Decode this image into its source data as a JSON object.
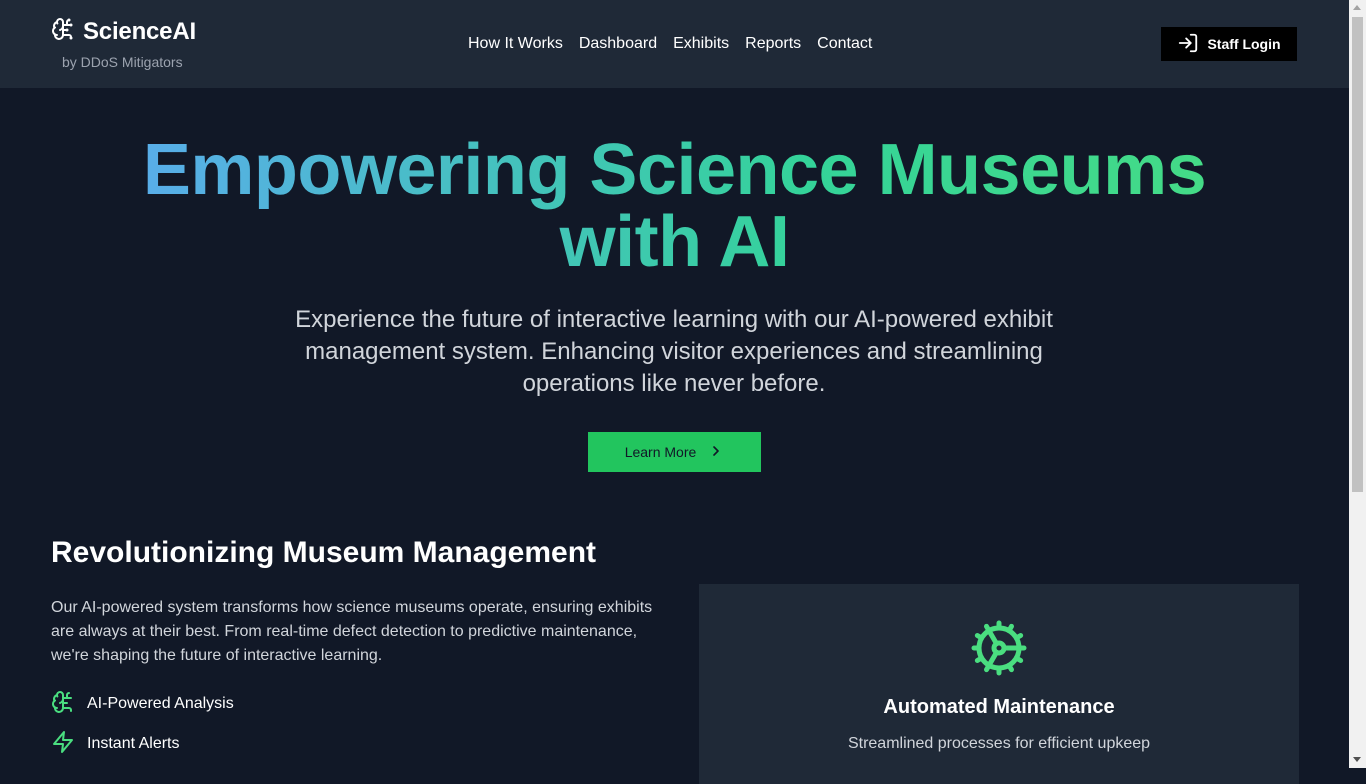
{
  "brand": {
    "name": "ScienceAI",
    "subtitle": "by DDoS Mitigators",
    "icon": "brain-icon"
  },
  "nav": {
    "links": [
      "How It Works",
      "Dashboard",
      "Exhibits",
      "Reports",
      "Contact"
    ],
    "login_label": "Staff Login",
    "login_icon": "log-in-icon"
  },
  "hero": {
    "title_line1": "Empowering Science Museums",
    "title_line2": "with AI",
    "subtitle": "Experience the future of interactive learning with our AI-powered exhibit management system. Enhancing visitor experiences and streamlining operations like never before.",
    "cta_label": "Learn More",
    "cta_icon": "chevron-right-icon"
  },
  "section": {
    "title": "Revolutionizing Museum Management",
    "body": "Our AI-powered system transforms how science museums operate, ensuring exhibits are always at their best. From real-time defect detection to predictive maintenance, we're shaping the future of interactive learning.",
    "features": [
      {
        "label": "AI-Powered Analysis",
        "icon": "brain-icon"
      },
      {
        "label": "Instant Alerts",
        "icon": "zap-icon"
      }
    ]
  },
  "card": {
    "icon": "gear-icon",
    "title": "Automated Maintenance",
    "description": "Streamlined processes for efficient upkeep"
  },
  "colors": {
    "accent": "#22c55e",
    "background": "#111827",
    "navbar": "#1f2937",
    "gradient_start": "#60a5fa",
    "gradient_end": "#4ade80"
  }
}
